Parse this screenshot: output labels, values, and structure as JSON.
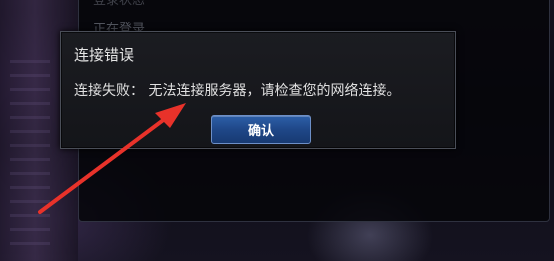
{
  "background": {
    "status_line_1": "登录状态",
    "status_line_2": "正在登录……"
  },
  "dialog": {
    "title": "连接错误",
    "message": "连接失败：  无法连接服务器，请检查您的网络连接。",
    "confirm_label": "确认"
  },
  "annotation": {
    "arrow_color": "#e8322a"
  }
}
